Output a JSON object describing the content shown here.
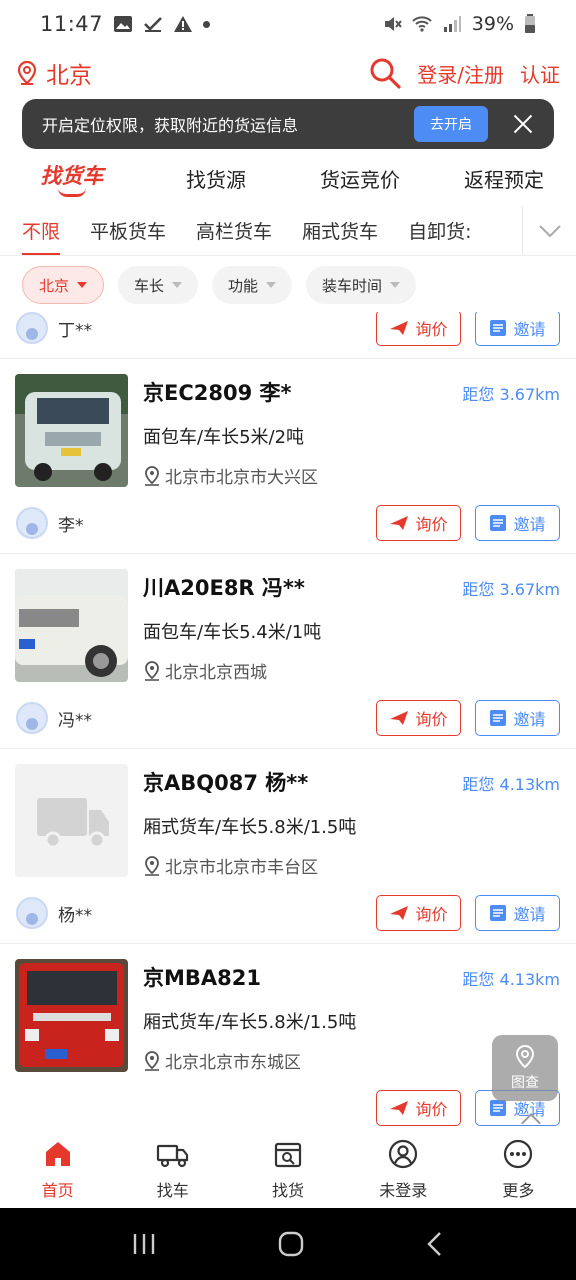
{
  "status": {
    "time": "11:47",
    "battery": "39%"
  },
  "header": {
    "city": "北京",
    "login": "登录/注册",
    "verify": "认证"
  },
  "banner": {
    "text": "开启定位权限，获取附近的货运信息",
    "button": "去开启"
  },
  "nav_tabs": [
    "找货车",
    "找货源",
    "货运竞价",
    "返程预定"
  ],
  "category_tabs": [
    "不限",
    "平板货车",
    "高栏货车",
    "厢式货车",
    "自卸货:"
  ],
  "filters": [
    "北京",
    "车长",
    "功能",
    "装车时间"
  ],
  "actions": {
    "ask": "询价",
    "invite": "邀请"
  },
  "partial_item": {
    "owner": "丁**"
  },
  "items": [
    {
      "title": "京EC2809 李*",
      "distance": "距您 3.67km",
      "spec": "面包车/车长5米/2吨",
      "address": "北京市北京市大兴区",
      "owner": "李*"
    },
    {
      "title": "川A20E8R 冯**",
      "distance": "距您 3.67km",
      "spec": "面包车/车长5.4米/1吨",
      "address": "北京北京西城",
      "owner": "冯**"
    },
    {
      "title": "京ABQ087 杨**",
      "distance": "距您 4.13km",
      "spec": "厢式货车/车长5.8米/1.5吨",
      "address": "北京市北京市丰台区",
      "owner": "杨**"
    },
    {
      "title": "京MBA821",
      "distance": "距您 4.13km",
      "spec": "厢式货车/车长5.8米/1.5吨",
      "address": "北京北京市东城区"
    }
  ],
  "float_button": {
    "label": "图查"
  },
  "bottom_nav": [
    "首页",
    "找车",
    "找货",
    "未登录",
    "更多"
  ],
  "colors": {
    "accent": "#e5392d",
    "link": "#4d8cf5"
  }
}
